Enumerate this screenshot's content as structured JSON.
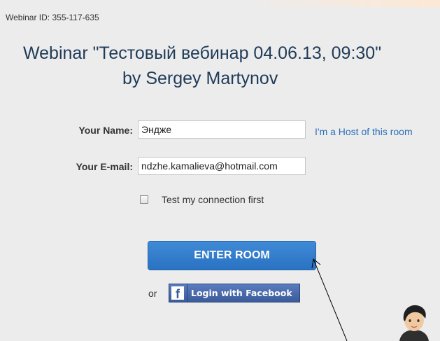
{
  "header": {
    "webinar_id": "Webinar ID: 355-117-635",
    "title_line1": "Webinar \"Тестовый вебинар 04.06.13, 09:30\"",
    "title_line2": "by Sergey Martynov"
  },
  "form": {
    "name_label": "Your Name:",
    "name_value": "Эндже",
    "host_link": "I'm a Host of this room",
    "email_label": "Your E-mail:",
    "email_value": "ndzhe.kamalieva@hotmail.com",
    "test_connection_label": "Test my connection first",
    "test_connection_checked": false
  },
  "actions": {
    "enter_label": "ENTER ROOM",
    "or_label": "or",
    "facebook_icon": "f",
    "facebook_label": "Login with Facebook"
  },
  "colors": {
    "accent": "#2a72c2",
    "facebook": "#3b5b9a",
    "link": "#2a6fb6",
    "title": "#1f3b57"
  }
}
